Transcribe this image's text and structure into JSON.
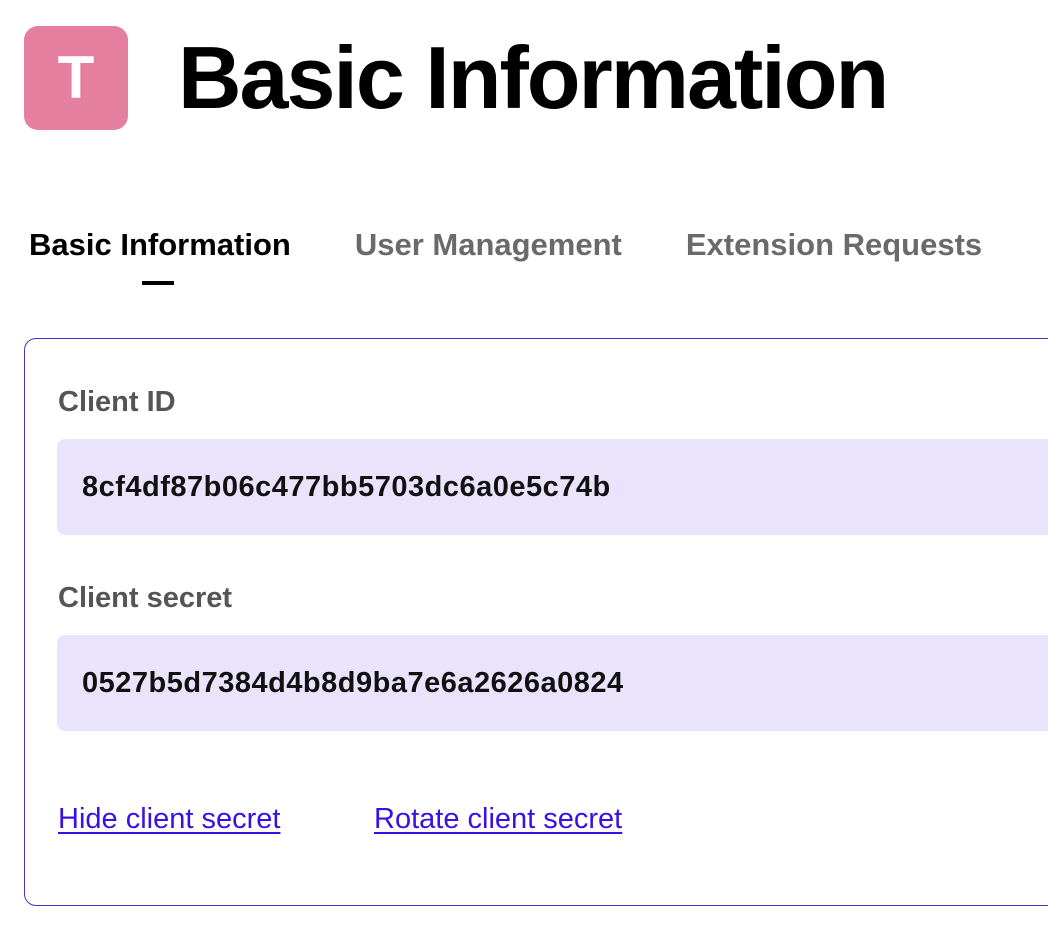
{
  "header": {
    "avatar_letter": "T",
    "title": "Basic Information"
  },
  "tabs": [
    {
      "label": "Basic Information",
      "active": true
    },
    {
      "label": "User Management",
      "active": false
    },
    {
      "label": "Extension Requests",
      "active": false
    }
  ],
  "credentials": {
    "client_id_label": "Client ID",
    "client_id_value": "8cf4df87b06c477bb5703dc6a0e5c74b",
    "client_secret_label": "Client secret",
    "client_secret_value": "0527b5d7384d4b8d9ba7e6a2626a0824"
  },
  "actions": {
    "hide_secret": "Hide client secret",
    "rotate_secret": "Rotate client secret"
  },
  "colors": {
    "avatar": "#e57f9f",
    "accent": "#3a10e5",
    "field_background": "#e9e4fb"
  }
}
